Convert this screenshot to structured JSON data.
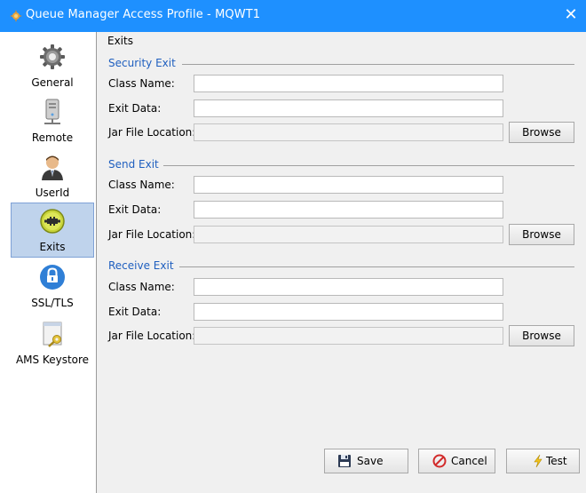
{
  "window": {
    "title": "Queue Manager Access Profile - MQWT1",
    "close_glyph": "✕"
  },
  "sidebar": {
    "items": [
      {
        "label": "General",
        "icon": "gear-icon"
      },
      {
        "label": "Remote",
        "icon": "computer-tower-icon"
      },
      {
        "label": "UserId",
        "icon": "user-icon"
      },
      {
        "label": "Exits",
        "icon": "plugin-icon",
        "selected": true
      },
      {
        "label": "SSL/TLS",
        "icon": "ssl-lock-icon"
      },
      {
        "label": "AMS Keystore",
        "icon": "key-document-icon"
      }
    ]
  },
  "main": {
    "group_title": "Exits",
    "sections": [
      {
        "title": "Security Exit",
        "class_name_label": "Class Name:",
        "class_name_value": "",
        "exit_data_label": "Exit Data:",
        "exit_data_value": "",
        "jar_label": "Jar File Location:",
        "jar_value": "",
        "browse_label": "Browse"
      },
      {
        "title": "Send Exit",
        "class_name_label": "Class Name:",
        "class_name_value": "",
        "exit_data_label": "Exit Data:",
        "exit_data_value": "",
        "jar_label": "Jar File Location:",
        "jar_value": "",
        "browse_label": "Browse"
      },
      {
        "title": "Receive Exit",
        "class_name_label": "Class Name:",
        "class_name_value": "",
        "exit_data_label": "Exit Data:",
        "exit_data_value": "",
        "jar_label": "Jar File Location:",
        "jar_value": "",
        "browse_label": "Browse"
      }
    ]
  },
  "buttons": {
    "save": "Save",
    "cancel": "Cancel",
    "test": "Test"
  },
  "colors": {
    "titlebar": "#1e90ff",
    "section_title": "#1f5fbf",
    "selected_nav": "#bfd3ec"
  }
}
